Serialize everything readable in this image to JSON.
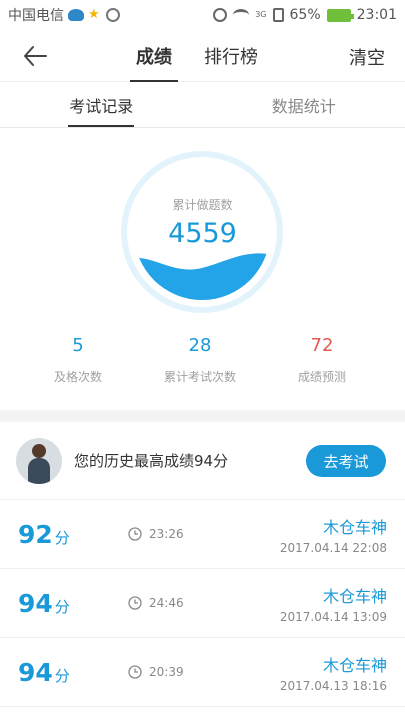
{
  "status_bar": {
    "carrier": "中国电信",
    "network": "3G",
    "battery": "65%",
    "time": "23:01",
    "icons": [
      "weather-icon",
      "star-icon",
      "settings-icon",
      "alarm-icon",
      "wifi-icon",
      "sim-icon",
      "battery-icon"
    ]
  },
  "nav": {
    "back_icon": "arrow-left-icon",
    "tabs": [
      {
        "label": "成绩",
        "active": true
      },
      {
        "label": "排行榜",
        "active": false
      }
    ],
    "clear_label": "清空"
  },
  "subtabs": [
    {
      "label": "考试记录",
      "active": true
    },
    {
      "label": "数据统计",
      "active": false
    }
  ],
  "summary": {
    "gauge_label": "累计做题数",
    "gauge_value": "4559",
    "stats": [
      {
        "value": "5",
        "label": "及格次数"
      },
      {
        "value": "28",
        "label": "累计考试次数"
      },
      {
        "value": "72",
        "label": "成绩预测"
      }
    ]
  },
  "profile": {
    "best_text": "您的历史最高成绩94分",
    "exam_button": "去考试"
  },
  "records": [
    {
      "score": "92",
      "unit": "分",
      "duration": "23:26",
      "name": "木仓车神",
      "date": "2017.04.14  22:08"
    },
    {
      "score": "94",
      "unit": "分",
      "duration": "24:46",
      "name": "木仓车神",
      "date": "2017.04.14  13:09"
    },
    {
      "score": "94",
      "unit": "分",
      "duration": "20:39",
      "name": "木仓车神",
      "date": "2017.04.13  18:16"
    }
  ],
  "colors": {
    "accent": "#1a99d8",
    "prediction": "#e05a4f",
    "muted": "#a0a0a0"
  }
}
